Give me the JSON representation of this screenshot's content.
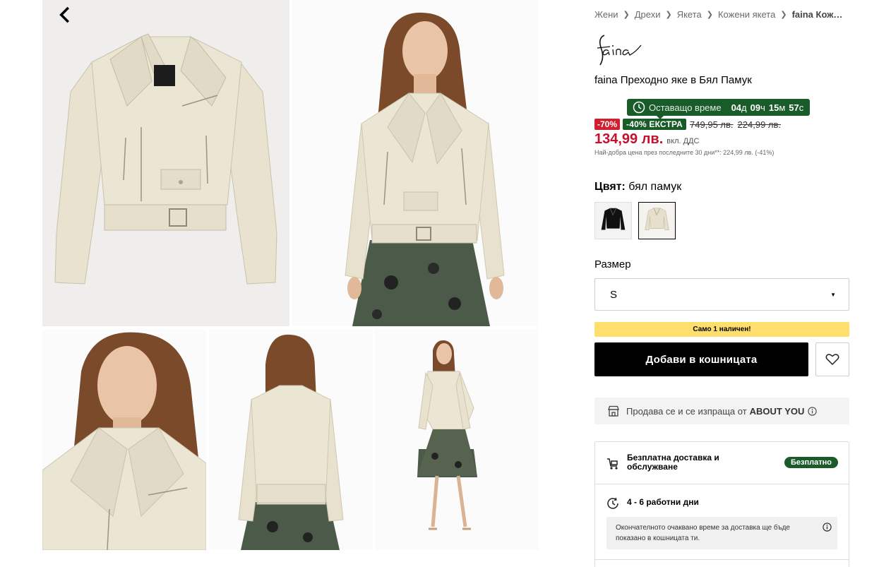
{
  "breadcrumb": [
    "Жени",
    "Дрехи",
    "Якета",
    "Кожени якета",
    "faina Кож…"
  ],
  "brand": {
    "logo_text": "faina"
  },
  "product": {
    "title": "faina Преходно яке в Бял Памук"
  },
  "countdown": {
    "label": "Оставащо време",
    "days": "04",
    "days_unit": "д",
    "hours": "09",
    "hours_unit": "ч",
    "minutes": "15",
    "minutes_unit": "м",
    "seconds": "57",
    "seconds_unit": "с"
  },
  "pricing": {
    "discount_badge": "-70%",
    "extra_badge": "-40% ЕКСТРА",
    "original_price": "749,95 лв.",
    "previous_price": "224,99 лв.",
    "current_price": "134,99 лв.",
    "vat_note": "вкл. ДДС",
    "best_price_note": "Най-добра цена през последните 30 дни**: 224,99 лв. (-41%)"
  },
  "color": {
    "label": "Цвят:",
    "value": "бял памук",
    "swatches": [
      {
        "name": "черно",
        "hex": "#111111"
      },
      {
        "name": "бял памук",
        "hex": "#ece6d6"
      }
    ]
  },
  "size": {
    "label": "Размер",
    "selected": "S"
  },
  "stock_notice": "Само 1 наличен!",
  "actions": {
    "add_to_cart": "Добави в кошницата"
  },
  "seller": {
    "prefix": "Продава се и се изпраща от",
    "name": "ABOUT YOU"
  },
  "delivery": {
    "free_title": "Безплатна доставка и обслужване",
    "free_badge": "Безплатно",
    "days": "4 - 6 работни дни",
    "note": "Окончателното очаквано време за доставка ще бъде показано в кошницата ти."
  },
  "colors": {
    "accent_green": "#1a5b2a",
    "sale_red": "#c8102e",
    "stock_yellow": "#fede6c",
    "jacket_cream": "#e9e3d2"
  }
}
